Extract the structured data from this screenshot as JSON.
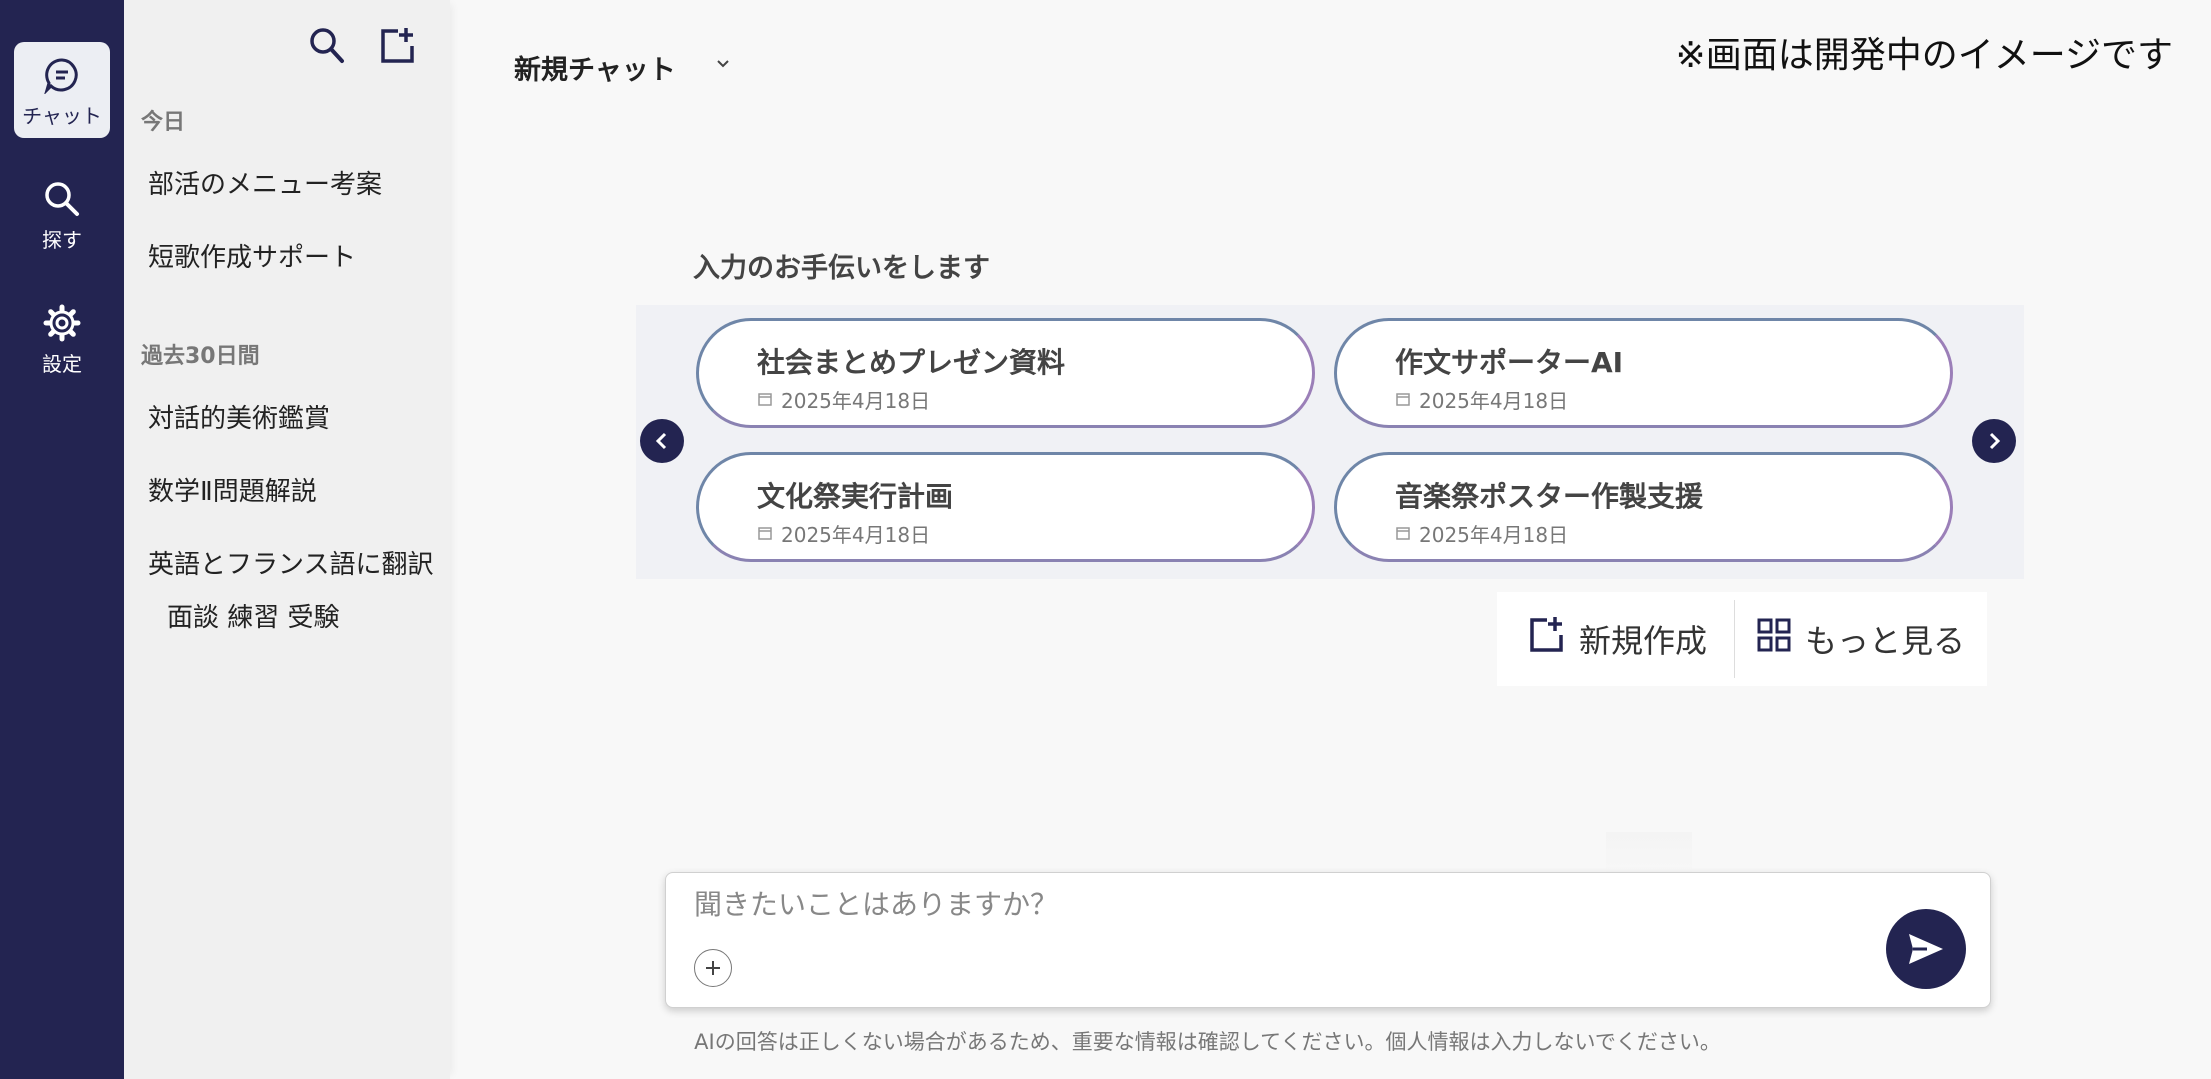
{
  "rail": {
    "items": [
      {
        "label": "チャット",
        "icon": "chat-icon"
      },
      {
        "label": "探す",
        "icon": "search-icon"
      },
      {
        "label": "設定",
        "icon": "gear-icon"
      }
    ]
  },
  "sidebar": {
    "sections": [
      {
        "heading": "今日",
        "items": [
          "部活のメニュー考案",
          "短歌作成サポート"
        ]
      },
      {
        "heading": "過去30日間",
        "items": [
          "対話的美術鑑賞",
          "数学Ⅱ問題解説",
          "英語とフランス語に翻訳"
        ]
      }
    ],
    "tags": "面談 練習 受験"
  },
  "header": {
    "title": "新規チャット",
    "notice": "※画面は開発中のイメージです"
  },
  "suggestions": {
    "heading": "入力のお手伝いをします",
    "cards": [
      {
        "title": "社会まとめプレゼン資料",
        "date": "2025年4月18日"
      },
      {
        "title": "作文サポーターAI",
        "date": "2025年4月18日"
      },
      {
        "title": "文化祭実行計画",
        "date": "2025年4月18日"
      },
      {
        "title": "音楽祭ポスター作製支援",
        "date": "2025年4月18日"
      }
    ]
  },
  "actions": {
    "new_label": "新規作成",
    "more_label": "もっと見る"
  },
  "composer": {
    "placeholder": "聞きたいことはありますか？"
  },
  "disclaimer": "AIの回答は正しくない場合があるため、重要な情報は確認してください。個人情報は入力しないでください。",
  "colors": {
    "rail": "#232451",
    "accent": "#232451",
    "sidebar": "#f0f0f0",
    "background": "#f8f8f8"
  }
}
